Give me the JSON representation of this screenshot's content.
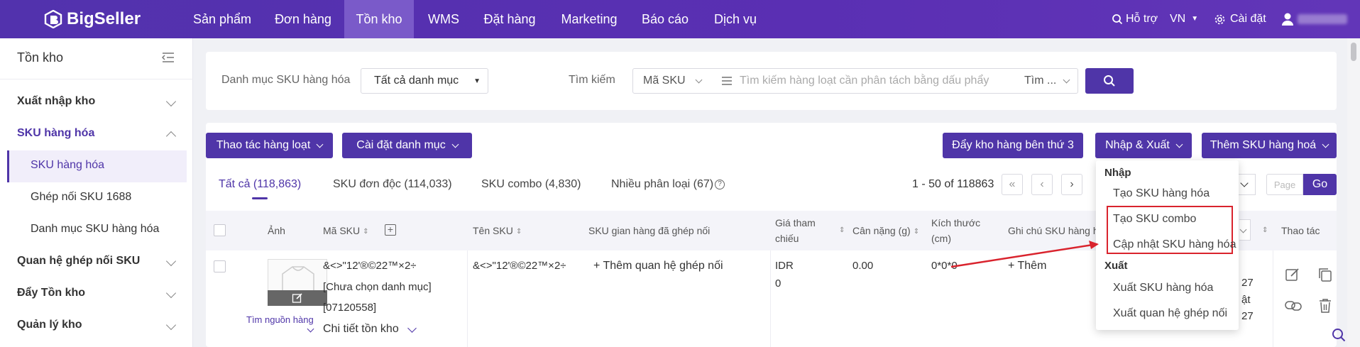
{
  "nav": {
    "brand": "BigSeller",
    "items": [
      "Sản phẩm",
      "Đơn hàng",
      "Tồn kho",
      "WMS",
      "Đặt hàng",
      "Marketing",
      "Báo cáo",
      "Dịch vụ"
    ],
    "support": "Hỗ trợ",
    "lang": "VN",
    "settings": "Cài đặt",
    "colors": {
      "nav_bg": "#5232ad",
      "active_tab": "#7a5ac9",
      "primary": "#4f35a8",
      "highlight": "#d9232d"
    }
  },
  "sidebar": {
    "title": "Tồn kho",
    "sections": [
      {
        "label": "Xuất nhập kho"
      },
      {
        "label": "SKU hàng hóa",
        "active": true
      },
      {
        "label": "Quan hệ ghép nối SKU"
      },
      {
        "label": "Đẩy Tồn kho"
      },
      {
        "label": "Quản lý kho"
      }
    ],
    "subitems": [
      "SKU hàng hóa",
      "Ghép nối SKU 1688",
      "Danh mục SKU hàng hóa"
    ]
  },
  "filter": {
    "category_label": "Danh mục SKU hàng hóa",
    "category_value": "Tất cả danh mục",
    "search_label": "Tìm kiếm",
    "search_field": "Mã SKU",
    "search_placeholder": "Tìm kiếm hàng loạt cần phân tách bằng dấu phẩy",
    "match_mode": "Tìm ..."
  },
  "toolbar": {
    "bulk": "Thao tác hàng loạt",
    "category_settings": "Cài đặt danh mục",
    "push_third_party": "Đẩy kho hàng bên thứ 3",
    "import_export": "Nhập & Xuất",
    "add_sku": "Thêm SKU hàng hoá"
  },
  "tabs": [
    "Tất cả (118,863)",
    "SKU đơn độc (114,033)",
    "SKU combo (4,830)",
    "Nhiều phân loại (67)"
  ],
  "pagination": {
    "range": "1 - 50 of 118863",
    "page_placeholder": "Page",
    "go": "Go"
  },
  "table": {
    "headers": {
      "image": "Ảnh",
      "sku_code": "Mã SKU",
      "sku_name": "Tên SKU",
      "linked": "SKU gian hàng đã ghép nối",
      "ref_price_1": "Giá tham",
      "ref_price_2": "chiếu",
      "weight": "Cân nặng (g)",
      "size_1": "Kích thước",
      "size_2": "(cm)",
      "note": "Ghi chú SKU hàng h",
      "actions": "Thao tác"
    },
    "row": {
      "find_source": "Tìm nguồn hàng",
      "sku_code": "&<>\"12'®©22™×2÷",
      "category": "[Chưa chọn danh mục]",
      "id": "[07120558]",
      "stock_detail": "Chi tiết tồn kho",
      "sku_name": "&<>\"12'®©22™×2÷",
      "add_link": "+ Thêm quan hệ ghép nối",
      "currency": "IDR",
      "price": "0",
      "weight": "0.00",
      "size": "0*0*0",
      "add_note": "+ Thêm",
      "partial_1": "27",
      "partial_2": "ật",
      "partial_3": "27"
    }
  },
  "dropdown": {
    "import_title": "Nhập",
    "import_items": [
      "Tạo SKU hàng hóa",
      "Tạo SKU combo",
      "Cập nhật SKU hàng hóa"
    ],
    "export_title": "Xuất",
    "export_items": [
      "Xuất SKU hàng hóa",
      "Xuất quan hệ ghép nối"
    ]
  }
}
